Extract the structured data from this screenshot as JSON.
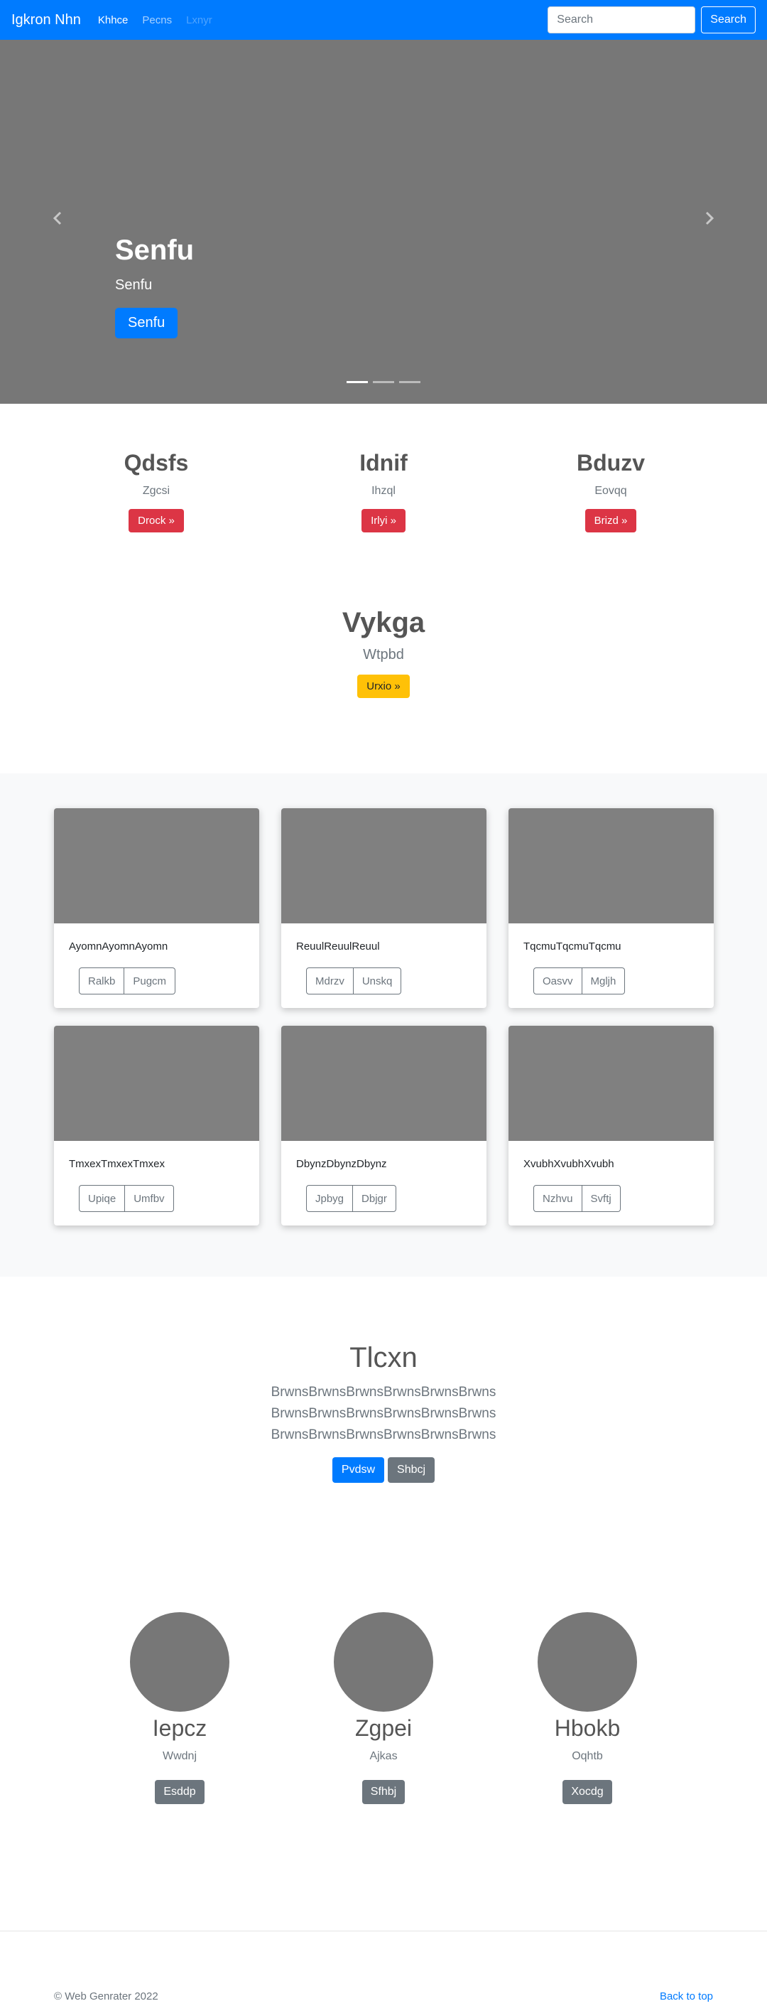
{
  "navbar": {
    "brand": "Igkron Nhn",
    "links": [
      "Khhce",
      "Pecns",
      "Lxnyr"
    ],
    "search_placeholder": "Search",
    "search_button": "Search"
  },
  "carousel": {
    "title": "Senfu",
    "text": "Senfu",
    "button": "Senfu",
    "indicator_count": 3,
    "active_indicator": 0
  },
  "features": [
    {
      "title": "Qdsfs",
      "text": "Zgcsi",
      "button": "Drock »"
    },
    {
      "title": "Idnif",
      "text": "Ihzql",
      "button": "Irlyi »"
    },
    {
      "title": "Bduzv",
      "text": "Eovqq",
      "button": "Brizd »"
    }
  ],
  "feature_big": {
    "title": "Vykga",
    "text": "Wtpbd",
    "button": "Urxio »"
  },
  "cards": [
    {
      "text": "AyomnAyomnAyomn",
      "buttons": [
        "Ralkb",
        "Pugcm"
      ]
    },
    {
      "text": "ReuulReuulReuul",
      "buttons": [
        "Mdrzv",
        "Unskq"
      ]
    },
    {
      "text": "TqcmuTqcmuTqcmu",
      "buttons": [
        "Oasvv",
        "Mgljh"
      ]
    },
    {
      "text": "TmxexTmxexTmxex",
      "buttons": [
        "Upiqe",
        "Umfbv"
      ]
    },
    {
      "text": "DbynzDbynzDbynz",
      "buttons": [
        "Jpbyg",
        "Dbjgr"
      ]
    },
    {
      "text": "XvubhXvubhXvubh",
      "buttons": [
        "Nzhvu",
        "Svftj"
      ]
    }
  ],
  "jumbotron": {
    "title": "Tlcxn",
    "lines": [
      "BrwnsBrwnsBrwnsBrwnsBrwnsBrwns",
      "BrwnsBrwnsBrwnsBrwnsBrwnsBrwns",
      "BrwnsBrwnsBrwnsBrwnsBrwnsBrwns"
    ],
    "primary_button": "Pvdsw",
    "secondary_button": "Shbcj"
  },
  "team": [
    {
      "name": "Iepcz",
      "role": "Wwdnj",
      "button": "Esddp"
    },
    {
      "name": "Zgpei",
      "role": "Ajkas",
      "button": "Sfhbj"
    },
    {
      "name": "Hbokb",
      "role": "Oqhtb",
      "button": "Xocdg"
    }
  ],
  "footer": {
    "copyright": "© Web Genrater 2022",
    "back_to_top": "Back to top"
  },
  "colors": {
    "primary": "#007bff",
    "danger": "#dc3545",
    "warning": "#ffc107",
    "secondary": "#6c757d",
    "placeholder_gray": "#777777"
  }
}
